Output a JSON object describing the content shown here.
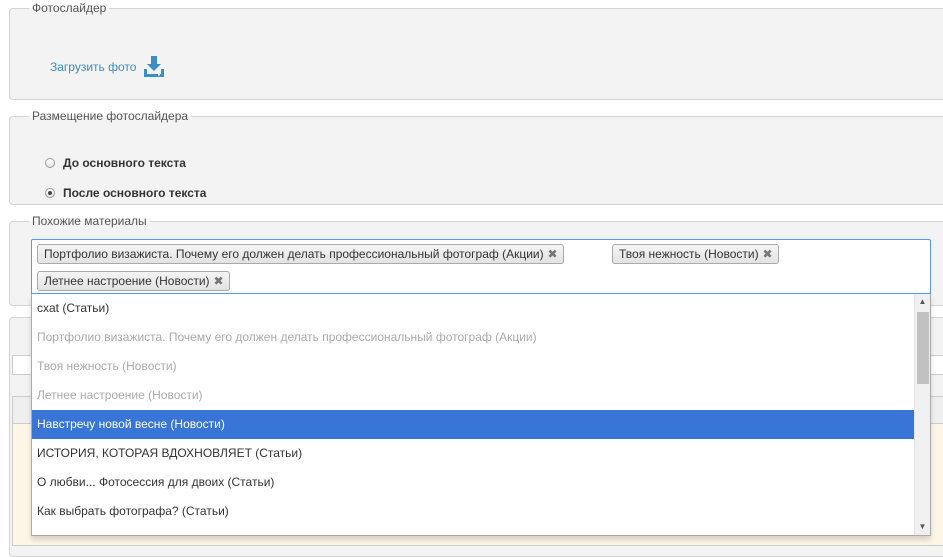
{
  "photo_slider": {
    "legend": "Фотослайдер",
    "upload_label": "Загрузить фото",
    "upload_icon": "download-icon"
  },
  "slider_placement": {
    "legend": "Размещение фотослайдера",
    "options": [
      {
        "label": "До основного текста",
        "checked": false
      },
      {
        "label": "После основного текста",
        "checked": true
      }
    ]
  },
  "related": {
    "legend": "Похожие материалы",
    "selected": [
      "Портфолио визажиста. Почему его должен делать профессиональный фотограф (Акции)",
      "Твоя нежность (Новости)",
      "Летнее настроение (Новости)"
    ],
    "remove_glyph": "✖",
    "dropdown_options": [
      {
        "label": "cxat (Статьи)",
        "state": "normal"
      },
      {
        "label": "Портфолио визажиста. Почему его должен делать профессиональный фотограф (Акции)",
        "state": "disabled"
      },
      {
        "label": "Твоя нежность (Новости)",
        "state": "disabled"
      },
      {
        "label": "Летнее настроение (Новости)",
        "state": "disabled"
      },
      {
        "label": "Навстречу новой весне (Новости)",
        "state": "highlighted"
      },
      {
        "label": "ИСТОРИЯ, КОТОРАЯ ВДОХНОВЛЯЕТ (Статьи)",
        "state": "normal"
      },
      {
        "label": "О любви... Фотосессия для двоих (Статьи)",
        "state": "normal"
      },
      {
        "label": "Как выбрать фотографа? (Статьи)",
        "state": "normal"
      }
    ]
  },
  "colors": {
    "link": "#3a8fc4",
    "highlight": "#3875d7",
    "focus_border": "#5897fb"
  }
}
